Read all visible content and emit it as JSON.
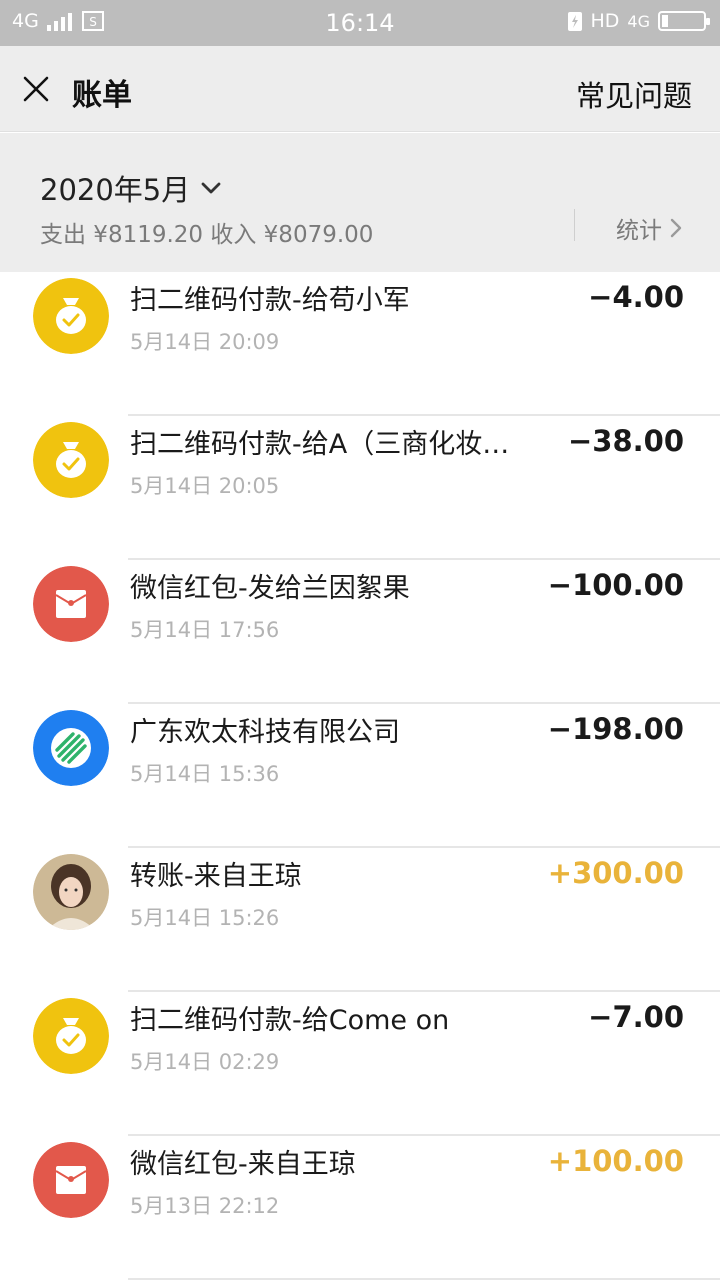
{
  "status_bar": {
    "network": "4G",
    "time": "16:14",
    "hd": "HD",
    "network_right": "4G"
  },
  "nav": {
    "title": "账单",
    "faq": "常见问题"
  },
  "summary": {
    "month": "2020年5月",
    "totals": "支出 ¥8119.20 收入 ¥8079.00",
    "stats_label": "统计"
  },
  "transactions": [
    {
      "title": "扫二维码付款-给苟小军",
      "time": "5月14日 20:09",
      "amount": "−4.00",
      "type": "expense",
      "icon": "money-bag-icon"
    },
    {
      "title": "扫二维码付款-给A（三商化妆…",
      "time": "5月14日 20:05",
      "amount": "−38.00",
      "type": "expense",
      "icon": "money-bag-icon"
    },
    {
      "title": "微信红包-发给兰因絮果",
      "time": "5月14日 17:56",
      "amount": "−100.00",
      "type": "expense",
      "icon": "red-packet-icon"
    },
    {
      "title": "广东欢太科技有限公司",
      "time": "5月14日 15:36",
      "amount": "−198.00",
      "type": "expense",
      "icon": "merchant-logo-icon"
    },
    {
      "title": "转账-来自王琼",
      "time": "5月14日 15:26",
      "amount": "+300.00",
      "type": "income",
      "icon": "user-avatar"
    },
    {
      "title": "扫二维码付款-给Come on",
      "time": "5月14日 02:29",
      "amount": "−7.00",
      "type": "expense",
      "icon": "money-bag-icon"
    },
    {
      "title": "微信红包-来自王琼",
      "time": "5月13日 22:12",
      "amount": "+100.00",
      "type": "income",
      "icon": "red-packet-icon"
    }
  ],
  "colors": {
    "income": "#e9b33a",
    "money_bag": "#f0c30f",
    "red_packet": "#e2584b",
    "merchant": "#1f7ff0"
  }
}
